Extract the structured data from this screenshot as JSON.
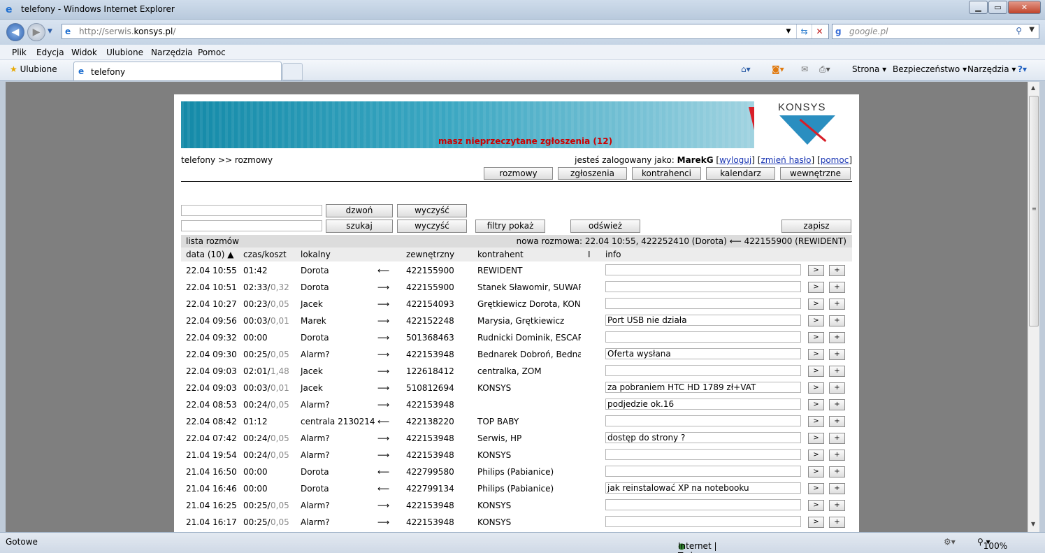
{
  "window": {
    "title": "telefony - Windows Internet Explorer"
  },
  "address": {
    "url_prefix": "http://serwis.",
    "url_domain": "konsys.pl",
    "url_suffix": "/"
  },
  "search": {
    "placeholder": "google.pl"
  },
  "menu": [
    "Plik",
    "Edycja",
    "Widok",
    "Ulubione",
    "Narzędzia",
    "Pomoc"
  ],
  "favorites": {
    "label": "Ulubione",
    "tab_label": "telefony"
  },
  "commandbar": {
    "page": "Strona",
    "security": "Bezpieczeństwo",
    "tools": "Narzędzia"
  },
  "status": {
    "left": "Gotowe",
    "zone": "Internet | Tryb chroniony: wyłączony",
    "zoom": "100%"
  },
  "page": {
    "logo": "KONSYS",
    "alert": "masz nieprzeczytane zgłoszenia (12)",
    "breadcrumb": "telefony >> rozmowy",
    "login_prefix": "jesteś zalogowany jako:",
    "user": "MarekG",
    "logout": "wyloguj",
    "change_pass": "zmień hasło",
    "help": "pomoc",
    "nav": [
      "rozmowy",
      "zgłoszenia",
      "kontrahenci",
      "kalendarz",
      "wewnętrzne"
    ],
    "buttons": {
      "call": "dzwoń",
      "clear": "wyczyść",
      "search": "szukaj",
      "filters": "filtry pokaż",
      "refresh": "odśwież",
      "save": "zapisz"
    },
    "list_label": "lista rozmów",
    "new_call": "nowa rozmowa: 22.04 10:55, 422252410 (Dorota) ⟵ 422155900 (REWIDENT)",
    "headers": {
      "date": "data (10) ▲",
      "time": "czas/koszt",
      "local": "lokalny",
      "external": "zewnętrzny",
      "contractor": "kontrahent",
      "i": "I",
      "info": "info"
    },
    "rows": [
      {
        "date": "22.04 10:55",
        "time": "01:42",
        "cost": "",
        "local": "Dorota",
        "dir": "⟵",
        "ext": "422155900",
        "contr": "REWIDENT",
        "info": ""
      },
      {
        "date": "22.04 10:51",
        "time": "02:33/",
        "cost": "0,32",
        "local": "Dorota",
        "dir": "⟶",
        "ext": "422155900",
        "contr": "Stanek Sławomir, SUWARY",
        "info": ""
      },
      {
        "date": "22.04 10:27",
        "time": "00:23/",
        "cost": "0,05",
        "local": "Jacek",
        "dir": "⟶",
        "ext": "422154093",
        "contr": "Grętkiewicz Dorota, KONSYS",
        "info": ""
      },
      {
        "date": "22.04 09:56",
        "time": "00:03/",
        "cost": "0,01",
        "local": "Marek",
        "dir": "⟶",
        "ext": "422152248",
        "contr": "Marysia, Grętkiewicz",
        "info": "Port USB nie działa"
      },
      {
        "date": "22.04 09:32",
        "time": "00:00",
        "cost": "",
        "local": "Dorota",
        "dir": "⟶",
        "ext": "501368463",
        "contr": "Rudnicki Dominik, ESCAPE",
        "info": ""
      },
      {
        "date": "22.04 09:30",
        "time": "00:25/",
        "cost": "0,05",
        "local": "Alarm?",
        "dir": "⟶",
        "ext": "422153948",
        "contr": "Bednarek Dobroń, Bednarek",
        "info": "Oferta wysłana"
      },
      {
        "date": "22.04 09:03",
        "time": "02:01/",
        "cost": "1,48",
        "local": "Jacek",
        "dir": "⟶",
        "ext": "122618412",
        "contr": "centralka, ZOM",
        "info": ""
      },
      {
        "date": "22.04 09:03",
        "time": "00:03/",
        "cost": "0,01",
        "local": "Jacek",
        "dir": "⟶",
        "ext": "510812694",
        "contr": "KONSYS",
        "info": "za pobraniem HTC HD 1789 zł+VAT"
      },
      {
        "date": "22.04 08:53",
        "time": "00:24/",
        "cost": "0,05",
        "local": "Alarm?",
        "dir": "⟶",
        "ext": "422153948",
        "contr": "",
        "info": "podjedzie ok.16"
      },
      {
        "date": "22.04 08:42",
        "time": "01:12",
        "cost": "",
        "local": "centrala 2130214",
        "dir": "⟵",
        "ext": "422138220",
        "contr": "TOP BABY",
        "info": ""
      },
      {
        "date": "22.04 07:42",
        "time": "00:24/",
        "cost": "0,05",
        "local": "Alarm?",
        "dir": "⟶",
        "ext": "422153948",
        "contr": "Serwis, HP",
        "info": "dostęp do strony ?"
      },
      {
        "date": "21.04 19:54",
        "time": "00:24/",
        "cost": "0,05",
        "local": "Alarm?",
        "dir": "⟶",
        "ext": "422153948",
        "contr": "KONSYS",
        "info": ""
      },
      {
        "date": "21.04 16:50",
        "time": "00:00",
        "cost": "",
        "local": "Dorota",
        "dir": "⟵",
        "ext": "422799580",
        "contr": "Philips (Pabianice)",
        "info": ""
      },
      {
        "date": "21.04 16:46",
        "time": "00:00",
        "cost": "",
        "local": "Dorota",
        "dir": "⟵",
        "ext": "422799134",
        "contr": "Philips (Pabianice)",
        "info": "jak reinstalować XP na notebooku"
      },
      {
        "date": "21.04 16:25",
        "time": "00:25/",
        "cost": "0,05",
        "local": "Alarm?",
        "dir": "⟶",
        "ext": "422153948",
        "contr": "KONSYS",
        "info": ""
      },
      {
        "date": "21.04 16:17",
        "time": "00:25/",
        "cost": "0,05",
        "local": "Alarm?",
        "dir": "⟶",
        "ext": "422153948",
        "contr": "KONSYS",
        "info": ""
      }
    ],
    "row_btn_go": ">",
    "row_btn_add": "+"
  }
}
